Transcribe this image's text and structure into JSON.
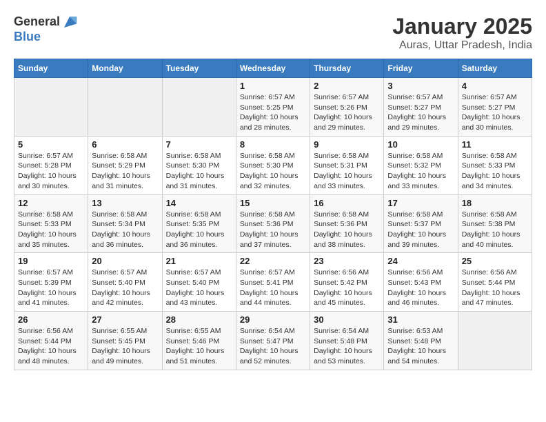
{
  "header": {
    "logo_line1": "General",
    "logo_line2": "Blue",
    "month": "January 2025",
    "location": "Auras, Uttar Pradesh, India"
  },
  "weekdays": [
    "Sunday",
    "Monday",
    "Tuesday",
    "Wednesday",
    "Thursday",
    "Friday",
    "Saturday"
  ],
  "weeks": [
    [
      {
        "day": "",
        "info": ""
      },
      {
        "day": "",
        "info": ""
      },
      {
        "day": "",
        "info": ""
      },
      {
        "day": "1",
        "info": "Sunrise: 6:57 AM\nSunset: 5:25 PM\nDaylight: 10 hours\nand 28 minutes."
      },
      {
        "day": "2",
        "info": "Sunrise: 6:57 AM\nSunset: 5:26 PM\nDaylight: 10 hours\nand 29 minutes."
      },
      {
        "day": "3",
        "info": "Sunrise: 6:57 AM\nSunset: 5:27 PM\nDaylight: 10 hours\nand 29 minutes."
      },
      {
        "day": "4",
        "info": "Sunrise: 6:57 AM\nSunset: 5:27 PM\nDaylight: 10 hours\nand 30 minutes."
      }
    ],
    [
      {
        "day": "5",
        "info": "Sunrise: 6:57 AM\nSunset: 5:28 PM\nDaylight: 10 hours\nand 30 minutes."
      },
      {
        "day": "6",
        "info": "Sunrise: 6:58 AM\nSunset: 5:29 PM\nDaylight: 10 hours\nand 31 minutes."
      },
      {
        "day": "7",
        "info": "Sunrise: 6:58 AM\nSunset: 5:30 PM\nDaylight: 10 hours\nand 31 minutes."
      },
      {
        "day": "8",
        "info": "Sunrise: 6:58 AM\nSunset: 5:30 PM\nDaylight: 10 hours\nand 32 minutes."
      },
      {
        "day": "9",
        "info": "Sunrise: 6:58 AM\nSunset: 5:31 PM\nDaylight: 10 hours\nand 33 minutes."
      },
      {
        "day": "10",
        "info": "Sunrise: 6:58 AM\nSunset: 5:32 PM\nDaylight: 10 hours\nand 33 minutes."
      },
      {
        "day": "11",
        "info": "Sunrise: 6:58 AM\nSunset: 5:33 PM\nDaylight: 10 hours\nand 34 minutes."
      }
    ],
    [
      {
        "day": "12",
        "info": "Sunrise: 6:58 AM\nSunset: 5:33 PM\nDaylight: 10 hours\nand 35 minutes."
      },
      {
        "day": "13",
        "info": "Sunrise: 6:58 AM\nSunset: 5:34 PM\nDaylight: 10 hours\nand 36 minutes."
      },
      {
        "day": "14",
        "info": "Sunrise: 6:58 AM\nSunset: 5:35 PM\nDaylight: 10 hours\nand 36 minutes."
      },
      {
        "day": "15",
        "info": "Sunrise: 6:58 AM\nSunset: 5:36 PM\nDaylight: 10 hours\nand 37 minutes."
      },
      {
        "day": "16",
        "info": "Sunrise: 6:58 AM\nSunset: 5:36 PM\nDaylight: 10 hours\nand 38 minutes."
      },
      {
        "day": "17",
        "info": "Sunrise: 6:58 AM\nSunset: 5:37 PM\nDaylight: 10 hours\nand 39 minutes."
      },
      {
        "day": "18",
        "info": "Sunrise: 6:58 AM\nSunset: 5:38 PM\nDaylight: 10 hours\nand 40 minutes."
      }
    ],
    [
      {
        "day": "19",
        "info": "Sunrise: 6:57 AM\nSunset: 5:39 PM\nDaylight: 10 hours\nand 41 minutes."
      },
      {
        "day": "20",
        "info": "Sunrise: 6:57 AM\nSunset: 5:40 PM\nDaylight: 10 hours\nand 42 minutes."
      },
      {
        "day": "21",
        "info": "Sunrise: 6:57 AM\nSunset: 5:40 PM\nDaylight: 10 hours\nand 43 minutes."
      },
      {
        "day": "22",
        "info": "Sunrise: 6:57 AM\nSunset: 5:41 PM\nDaylight: 10 hours\nand 44 minutes."
      },
      {
        "day": "23",
        "info": "Sunrise: 6:56 AM\nSunset: 5:42 PM\nDaylight: 10 hours\nand 45 minutes."
      },
      {
        "day": "24",
        "info": "Sunrise: 6:56 AM\nSunset: 5:43 PM\nDaylight: 10 hours\nand 46 minutes."
      },
      {
        "day": "25",
        "info": "Sunrise: 6:56 AM\nSunset: 5:44 PM\nDaylight: 10 hours\nand 47 minutes."
      }
    ],
    [
      {
        "day": "26",
        "info": "Sunrise: 6:56 AM\nSunset: 5:44 PM\nDaylight: 10 hours\nand 48 minutes."
      },
      {
        "day": "27",
        "info": "Sunrise: 6:55 AM\nSunset: 5:45 PM\nDaylight: 10 hours\nand 49 minutes."
      },
      {
        "day": "28",
        "info": "Sunrise: 6:55 AM\nSunset: 5:46 PM\nDaylight: 10 hours\nand 51 minutes."
      },
      {
        "day": "29",
        "info": "Sunrise: 6:54 AM\nSunset: 5:47 PM\nDaylight: 10 hours\nand 52 minutes."
      },
      {
        "day": "30",
        "info": "Sunrise: 6:54 AM\nSunset: 5:48 PM\nDaylight: 10 hours\nand 53 minutes."
      },
      {
        "day": "31",
        "info": "Sunrise: 6:53 AM\nSunset: 5:48 PM\nDaylight: 10 hours\nand 54 minutes."
      },
      {
        "day": "",
        "info": ""
      }
    ]
  ]
}
